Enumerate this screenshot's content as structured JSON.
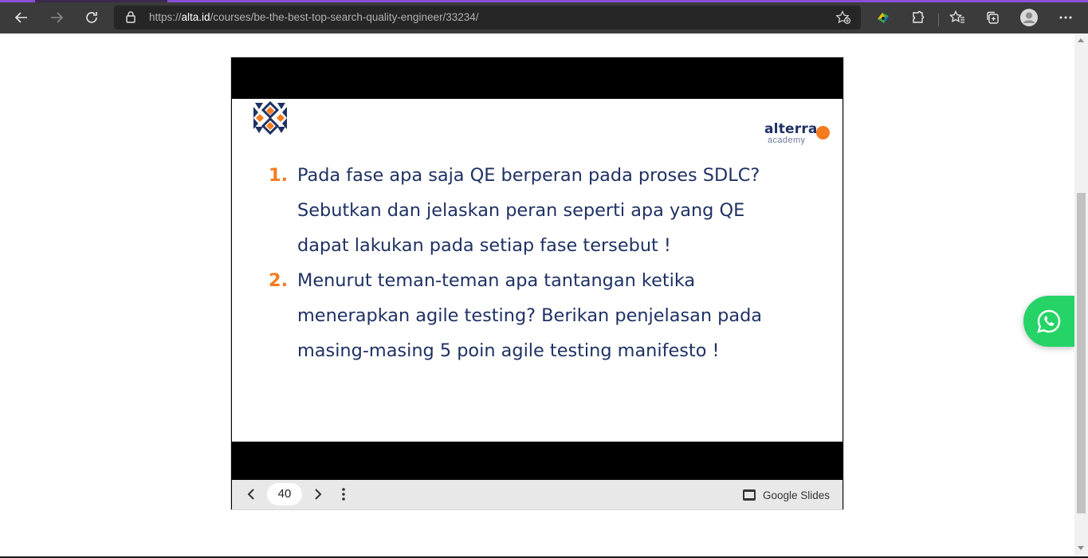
{
  "browser": {
    "url_scheme": "https://",
    "url_host": "alta.id",
    "url_path": "/courses/be-the-best-top-search-quality-engineer/33234/",
    "icons": [
      "back-icon",
      "forward-icon",
      "refresh-icon",
      "lock-icon",
      "add-favorite-icon",
      "extension-colorful-icon",
      "extensions-icon",
      "favorites-icon",
      "collections-icon",
      "profile-icon",
      "more-icon"
    ]
  },
  "slide": {
    "brand_name": "alterra",
    "brand_sub": "academy",
    "questions": [
      {
        "num": "1.",
        "lines": [
          "Pada fase apa saja QE berperan pada proses SDLC?",
          "Sebutkan dan jelaskan peran seperti apa yang QE",
          "dapat lakukan pada setiap fase tersebut !"
        ]
      },
      {
        "num": "2.",
        "lines": [
          "Menurut teman-teman apa tantangan ketika",
          "menerapkan agile testing? Berikan penjelasan pada",
          "masing-masing 5 poin agile testing manifesto !"
        ]
      }
    ]
  },
  "controls": {
    "page_number": "40",
    "service_label": "Google Slides"
  },
  "colors": {
    "accent_orange": "#f47b20",
    "navy": "#1f3163",
    "whatsapp_green": "#25d366",
    "chrome_dark": "#3b3b3b"
  }
}
